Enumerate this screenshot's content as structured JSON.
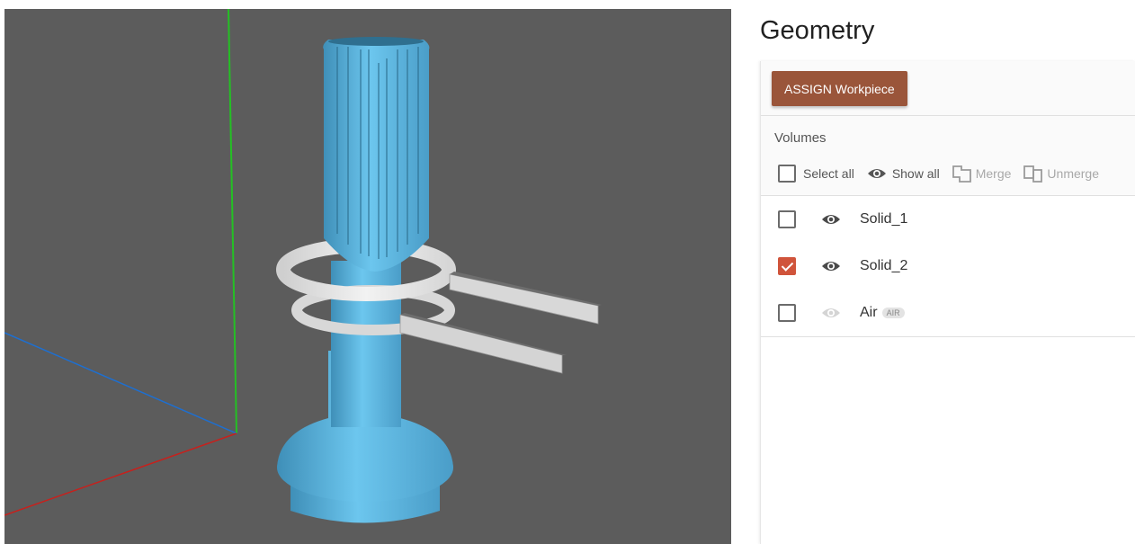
{
  "viewport": {
    "background": "#5c5c5c",
    "axes": {
      "x_color": "#c8201c",
      "y_color": "#24c024",
      "z_color": "#1e6fd0"
    },
    "model_color": "#62bde8",
    "coil_color": "#e0e0e0"
  },
  "panel": {
    "title": "Geometry",
    "assign_button": "ASSIGN Workpiece",
    "volumes_label": "Volumes",
    "toolbar": {
      "select_all": "Select all",
      "show_all": "Show all",
      "merge": "Merge",
      "unmerge": "Unmerge"
    },
    "volumes": [
      {
        "name": "Solid_1",
        "checked": false,
        "visible": true,
        "badge": ""
      },
      {
        "name": "Solid_2",
        "checked": true,
        "visible": true,
        "badge": ""
      },
      {
        "name": "Air",
        "checked": false,
        "visible": false,
        "badge": "AIR"
      }
    ],
    "accent_color": "#9a553a",
    "checkbox_color": "#d0543b"
  }
}
